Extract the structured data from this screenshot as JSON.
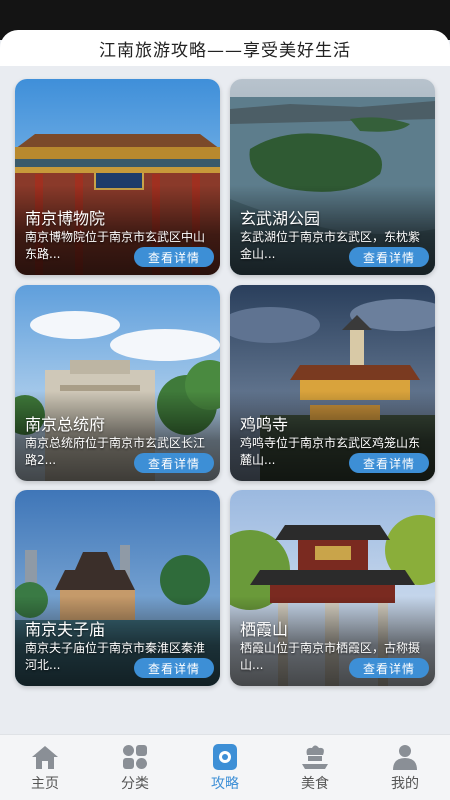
{
  "header": {
    "title": "江南旅游攻略——享受美好生活"
  },
  "cards": [
    {
      "title": "南京博物院",
      "desc": "南京博物院位于南京市玄武区中山东路...",
      "button": "查看详情"
    },
    {
      "title": "玄武湖公园",
      "desc": "玄武湖位于南京市玄武区，东枕紫金山...",
      "button": "查看详情"
    },
    {
      "title": "南京总统府",
      "desc": "南京总统府位于南京市玄武区长江路2...",
      "button": "查看详情"
    },
    {
      "title": "鸡鸣寺",
      "desc": "鸡鸣寺位于南京市玄武区鸡笼山东麓山...",
      "button": "查看详情"
    },
    {
      "title": "南京夫子庙",
      "desc": "南京夫子庙位于南京市秦淮区秦淮河北...",
      "button": "查看详情"
    },
    {
      "title": "栖霞山",
      "desc": "栖霞山位于南京市栖霞区，古称摄山...",
      "button": "查看详情"
    }
  ],
  "tabs": [
    {
      "label": "主页",
      "icon": "home-icon"
    },
    {
      "label": "分类",
      "icon": "category-icon"
    },
    {
      "label": "攻略",
      "icon": "guide-icon",
      "active": true
    },
    {
      "label": "美食",
      "icon": "food-icon"
    },
    {
      "label": "我的",
      "icon": "user-icon"
    }
  ],
  "colors": {
    "accent": "#3d8fd6",
    "tab_inactive": "#8a8f96"
  }
}
